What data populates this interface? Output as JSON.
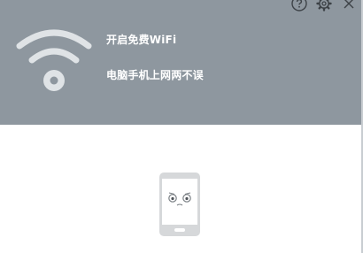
{
  "header": {
    "headline": "开启免费WiFi",
    "subline": "电脑手机上网两不误"
  },
  "window_controls": {
    "help_icon": "question-circle-icon",
    "settings_icon": "gear-icon",
    "close_icon": "close-icon"
  },
  "colors": {
    "header_bg": "#8e979f",
    "icon_light": "#dfe3e6",
    "phone_gray": "#d6d8da"
  },
  "illustration": {
    "icon": "sad-phone-icon"
  }
}
